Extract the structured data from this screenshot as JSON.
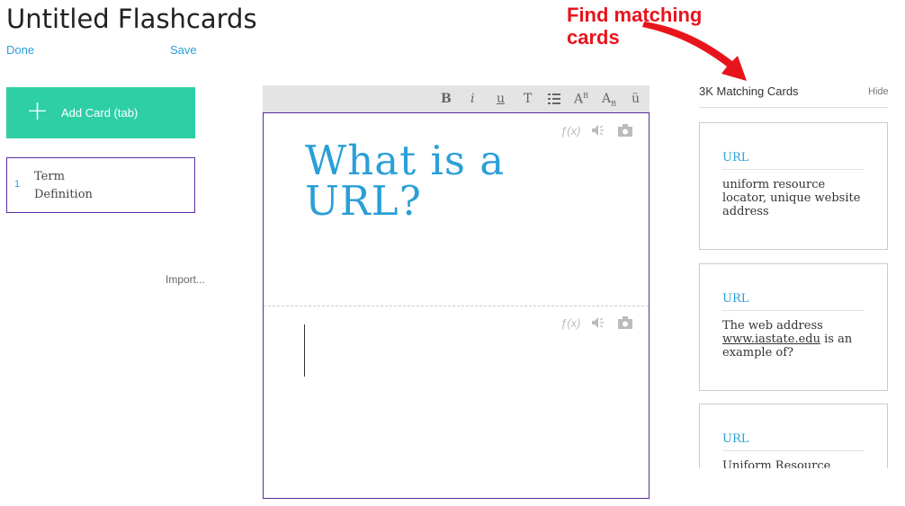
{
  "header": {
    "title": "Untitled Flashcards",
    "done_label": "Done",
    "save_label": "Save"
  },
  "annotation": {
    "line1": "Find matching",
    "line2": "cards",
    "color": "#e8141c"
  },
  "sidebar": {
    "add_card_label": "Add Card (tab)",
    "add_card_icon": "plus-icon",
    "add_card_color": "#2ecfa5",
    "card_item": {
      "number": "1",
      "term": "Term",
      "definition": "Definition"
    },
    "import_label": "Import..."
  },
  "toolbar": {
    "bold": "B",
    "italic": "i",
    "underline": "u",
    "text": "T",
    "list": "list-icon",
    "superscript": "A",
    "superscript_mark": "B",
    "subscript": "A",
    "subscript_mark": "B",
    "umlaut": "ü"
  },
  "editor": {
    "front_text_line1": "What is a",
    "front_text_line2": "URL?",
    "back_text": "",
    "tools": {
      "formula": "ƒ(x)",
      "audio": "speaker-icon",
      "image": "camera-icon"
    }
  },
  "matching": {
    "count_label": "3K Matching Cards",
    "hide_label": "Hide",
    "cards": [
      {
        "term": "URL",
        "definition": "uniform resource locator, unique website address"
      },
      {
        "term": "URL",
        "definition_pre": "The web address ",
        "definition_link": "www.iastate.edu",
        "definition_post": " is an example of?"
      },
      {
        "term": "URL",
        "definition": "Uniform Resource"
      }
    ]
  },
  "colors": {
    "accent_blue": "#2a9fd8",
    "border_purple": "#5a2ca0"
  }
}
